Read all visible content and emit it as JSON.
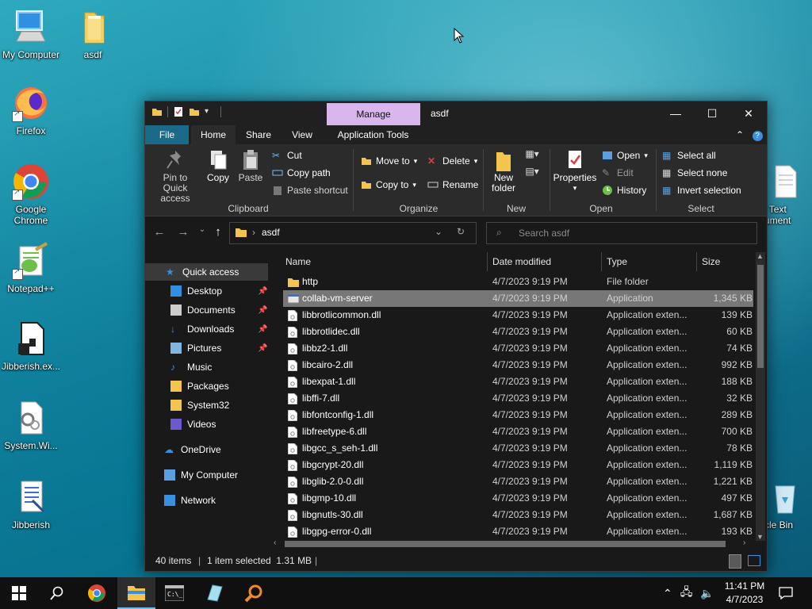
{
  "desktop": {
    "icons": [
      {
        "label": "My Computer"
      },
      {
        "label": "asdf"
      },
      {
        "label": "Firefox"
      },
      {
        "label": "Google Chrome"
      },
      {
        "label": "Notepad++"
      },
      {
        "label": "Jibberish.ex..."
      },
      {
        "label": "System.Wi..."
      },
      {
        "label": "Jibberish"
      },
      {
        "label": "w Text\ncument"
      },
      {
        "label": "ycle Bin"
      }
    ]
  },
  "window": {
    "title": "asdf",
    "manage_tab": "Manage",
    "ribbon_tabs": [
      "File",
      "Home",
      "Share",
      "View",
      "Application Tools"
    ],
    "ribbon": {
      "clipboard": {
        "pin": "Pin to Quick access",
        "copy": "Copy",
        "paste": "Paste",
        "cut": "Cut",
        "copy_path": "Copy path",
        "paste_shortcut": "Paste shortcut",
        "label": "Clipboard"
      },
      "organize": {
        "move_to": "Move to",
        "copy_to": "Copy to",
        "delete": "Delete",
        "rename": "Rename",
        "label": "Organize"
      },
      "new": {
        "new_folder": "New folder",
        "label": "New"
      },
      "open": {
        "properties": "Properties",
        "open": "Open",
        "edit": "Edit",
        "history": "History",
        "label": "Open"
      },
      "select": {
        "select_all": "Select all",
        "select_none": "Select none",
        "invert": "Invert selection",
        "label": "Select"
      }
    },
    "address": {
      "path": "asdf",
      "search_placeholder": "Search asdf"
    },
    "nav": [
      {
        "label": "Quick access",
        "pinned": false
      },
      {
        "label": "Desktop",
        "pinned": true
      },
      {
        "label": "Documents",
        "pinned": true
      },
      {
        "label": "Downloads",
        "pinned": true
      },
      {
        "label": "Pictures",
        "pinned": true
      },
      {
        "label": "Music",
        "pinned": false
      },
      {
        "label": "Packages",
        "pinned": false
      },
      {
        "label": "System32",
        "pinned": false
      },
      {
        "label": "Videos",
        "pinned": false
      },
      {
        "label": "OneDrive",
        "pinned": false
      },
      {
        "label": "My Computer",
        "pinned": false
      },
      {
        "label": "Network",
        "pinned": false
      }
    ],
    "columns": [
      "Name",
      "Date modified",
      "Type",
      "Size"
    ],
    "files": [
      {
        "name": "http",
        "date": "4/7/2023 9:19 PM",
        "type": "File folder",
        "size": "",
        "kind": "folder"
      },
      {
        "name": "collab-vm-server",
        "date": "4/7/2023 9:19 PM",
        "type": "Application",
        "size": "1,345 KB",
        "kind": "app",
        "selected": true
      },
      {
        "name": "libbrotlicommon.dll",
        "date": "4/7/2023 9:19 PM",
        "type": "Application exten...",
        "size": "139 KB",
        "kind": "dll"
      },
      {
        "name": "libbrotlidec.dll",
        "date": "4/7/2023 9:19 PM",
        "type": "Application exten...",
        "size": "60 KB",
        "kind": "dll"
      },
      {
        "name": "libbz2-1.dll",
        "date": "4/7/2023 9:19 PM",
        "type": "Application exten...",
        "size": "74 KB",
        "kind": "dll"
      },
      {
        "name": "libcairo-2.dll",
        "date": "4/7/2023 9:19 PM",
        "type": "Application exten...",
        "size": "992 KB",
        "kind": "dll"
      },
      {
        "name": "libexpat-1.dll",
        "date": "4/7/2023 9:19 PM",
        "type": "Application exten...",
        "size": "188 KB",
        "kind": "dll"
      },
      {
        "name": "libffi-7.dll",
        "date": "4/7/2023 9:19 PM",
        "type": "Application exten...",
        "size": "32 KB",
        "kind": "dll"
      },
      {
        "name": "libfontconfig-1.dll",
        "date": "4/7/2023 9:19 PM",
        "type": "Application exten...",
        "size": "289 KB",
        "kind": "dll"
      },
      {
        "name": "libfreetype-6.dll",
        "date": "4/7/2023 9:19 PM",
        "type": "Application exten...",
        "size": "700 KB",
        "kind": "dll"
      },
      {
        "name": "libgcc_s_seh-1.dll",
        "date": "4/7/2023 9:19 PM",
        "type": "Application exten...",
        "size": "78 KB",
        "kind": "dll"
      },
      {
        "name": "libgcrypt-20.dll",
        "date": "4/7/2023 9:19 PM",
        "type": "Application exten...",
        "size": "1,119 KB",
        "kind": "dll"
      },
      {
        "name": "libglib-2.0-0.dll",
        "date": "4/7/2023 9:19 PM",
        "type": "Application exten...",
        "size": "1,221 KB",
        "kind": "dll"
      },
      {
        "name": "libgmp-10.dll",
        "date": "4/7/2023 9:19 PM",
        "type": "Application exten...",
        "size": "497 KB",
        "kind": "dll"
      },
      {
        "name": "libgnutls-30.dll",
        "date": "4/7/2023 9:19 PM",
        "type": "Application exten...",
        "size": "1,687 KB",
        "kind": "dll"
      },
      {
        "name": "libgpg-error-0.dll",
        "date": "4/7/2023 9:19 PM",
        "type": "Application exten...",
        "size": "193 KB",
        "kind": "dll"
      }
    ],
    "status": {
      "items": "40 items",
      "selected": "1 item selected  1.31 MB"
    }
  },
  "taskbar": {
    "time": "11:41 PM",
    "date": "4/7/2023"
  },
  "colors": {
    "accent": "#76b9ed",
    "manage_tab": "#d9b6ee",
    "file_tab": "#1b6a8a",
    "folder": "#f3c54e"
  }
}
